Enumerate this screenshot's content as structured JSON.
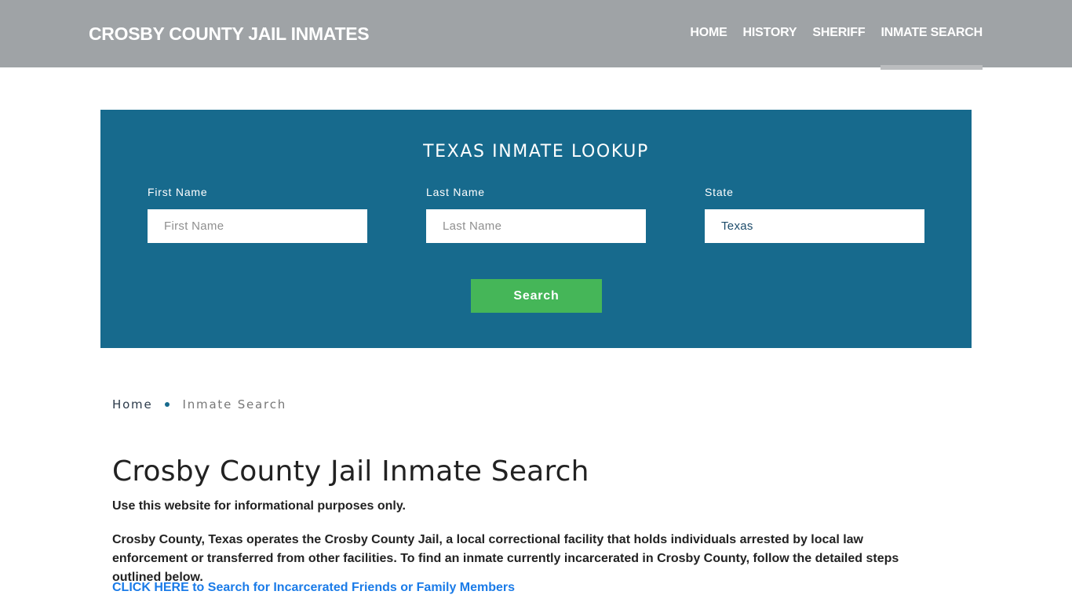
{
  "header": {
    "brand": "CROSBY COUNTY JAIL INMATES",
    "nav": [
      {
        "label": "HOME",
        "active": false
      },
      {
        "label": "HISTORY",
        "active": false
      },
      {
        "label": "SHERIFF",
        "active": false
      },
      {
        "label": "INMATE SEARCH",
        "active": true
      }
    ]
  },
  "lookup": {
    "title": "TEXAS INMATE LOOKUP",
    "fields": [
      {
        "label": "First Name",
        "placeholder": "First Name",
        "value": ""
      },
      {
        "label": "Last Name",
        "placeholder": "Last Name",
        "value": ""
      },
      {
        "label": "State",
        "placeholder": "",
        "value": "Texas"
      }
    ],
    "search_label": "Search"
  },
  "breadcrumb": {
    "home": "Home",
    "current": "Inmate Search"
  },
  "content": {
    "title": "Crosby County Jail Inmate Search",
    "disclaimer": "Use this website for informational purposes only.",
    "intro": "Crosby County, Texas operates the Crosby County Jail, a local correctional facility that holds individuals arrested by local law enforcement or transferred from other facilities. To find an inmate currently incarcerated in Crosby County, follow the detailed steps outlined below.",
    "cta_link": "CLICK HERE to Search for Incarcerated Friends or Family Members"
  },
  "colors": {
    "header_bg": "#9fa3a6",
    "lookup_bg": "#176a8d",
    "search_button": "#45b658",
    "link": "#1a7be8"
  }
}
